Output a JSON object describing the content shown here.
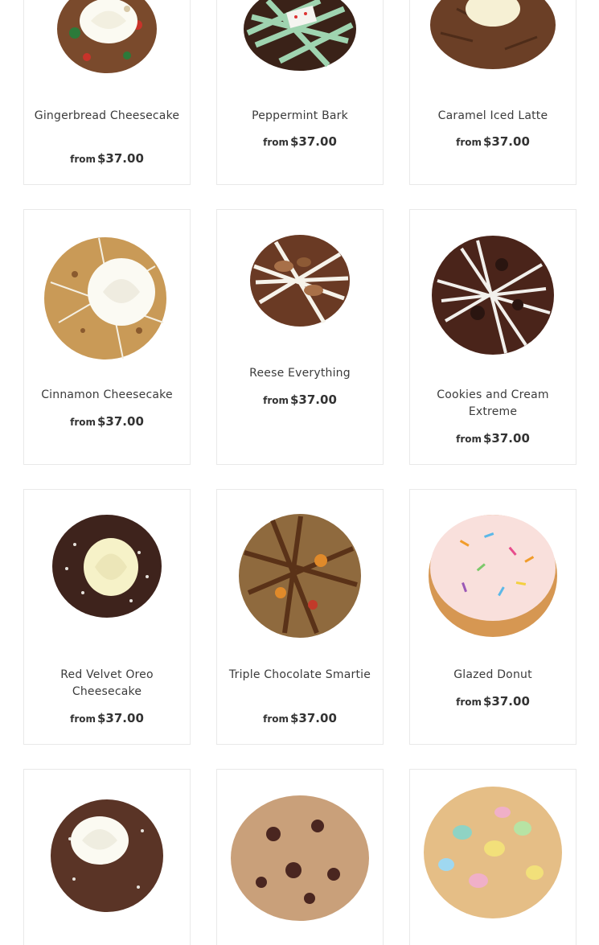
{
  "products": [
    {
      "name": "Gingerbread Cheesecake",
      "from_label": "from",
      "price": "$37.00",
      "image_icon": "gingerbread-cheesecake-cookie-image"
    },
    {
      "name": "Peppermint Bark",
      "from_label": "from",
      "price": "$37.00",
      "image_icon": "peppermint-bark-cookie-image"
    },
    {
      "name": "Caramel Iced Latte",
      "from_label": "from",
      "price": "$37.00",
      "image_icon": "caramel-iced-latte-cookie-image"
    },
    {
      "name": "Cinnamon Cheesecake",
      "from_label": "from",
      "price": "$37.00",
      "image_icon": "cinnamon-cheesecake-cookie-image"
    },
    {
      "name": "Reese Everything",
      "from_label": "from",
      "price": "$37.00",
      "image_icon": "reese-everything-cookie-image"
    },
    {
      "name": "Cookies and Cream Extreme",
      "from_label": "from",
      "price": "$37.00",
      "image_icon": "cookies-and-cream-cookie-image"
    },
    {
      "name": "Red Velvet Oreo Cheesecake",
      "from_label": "from",
      "price": "$37.00",
      "image_icon": "red-velvet-oreo-cookie-image"
    },
    {
      "name": "Triple Chocolate Smartie",
      "from_label": "from",
      "price": "$37.00",
      "image_icon": "triple-chocolate-smartie-cookie-image"
    },
    {
      "name": "Glazed Donut",
      "from_label": "from",
      "price": "$37.00",
      "image_icon": "glazed-donut-cookie-image"
    },
    {
      "name": "",
      "from_label": "",
      "price": "",
      "image_icon": "chocolate-cheesecake-cookie-image"
    },
    {
      "name": "",
      "from_label": "",
      "price": "",
      "image_icon": "oatmeal-raisin-cookie-image"
    },
    {
      "name": "",
      "from_label": "",
      "price": "",
      "image_icon": "mini-egg-cookie-image"
    }
  ]
}
